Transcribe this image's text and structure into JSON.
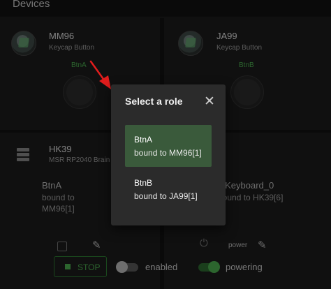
{
  "section": {
    "title": "Devices"
  },
  "devices": [
    {
      "name": "MM96",
      "type": "Keycap Button",
      "button_label": "BtnA"
    },
    {
      "name": "JA99",
      "type": "Keycap Button",
      "button_label": "BtnB"
    },
    {
      "name": "HK39",
      "type": "MSR RP2040 Brain"
    }
  ],
  "bindings": {
    "left": {
      "role": "BtnA",
      "bound_prefix": "bound to",
      "bound_target": "MM96[1]"
    },
    "right": {
      "role": "idKeyboard_0",
      "bound": "bound to HK39[6]"
    }
  },
  "controls": {
    "stop_label": "STOP",
    "enabled_label": "enabled",
    "enabled_on": false,
    "powering_label": "powering",
    "powering_on": true,
    "power_label": "power"
  },
  "dialog": {
    "title": "Select a role",
    "close_glyph": "✕",
    "roles": [
      {
        "name": "BtnA",
        "bound": "bound to MM96[1]",
        "selected": true
      },
      {
        "name": "BtnB",
        "bound": "bound to JA99[1]",
        "selected": false
      }
    ]
  },
  "icons": {
    "pencil_glyph": "✎",
    "power_glyph": "⏻"
  },
  "colors": {
    "accent_green": "#4caf50",
    "selected_bg": "#3a5a3b",
    "arrow_red": "#e11d1d"
  }
}
